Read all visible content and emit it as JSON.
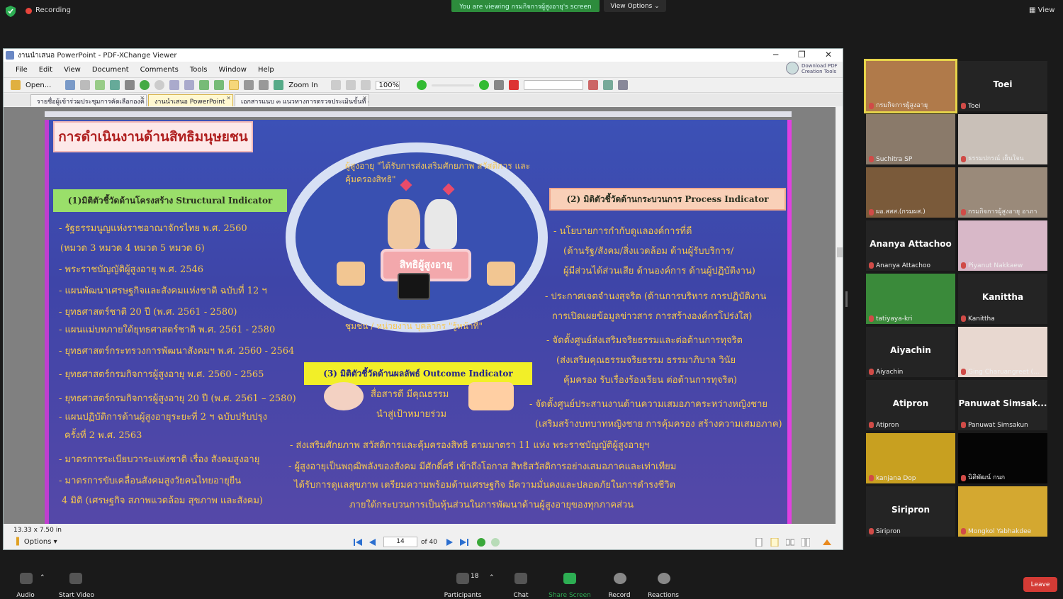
{
  "zoom": {
    "recording_label": "Recording",
    "viewing_banner": "You are viewing กรมกิจการผู้สูงอายุ's screen",
    "view_options": "View Options ⌄",
    "view_label": "View"
  },
  "window": {
    "title": "งานนำเสนอ PowerPoint - PDF-XChange Viewer",
    "menu": [
      "File",
      "Edit",
      "View",
      "Document",
      "Comments",
      "Tools",
      "Window",
      "Help"
    ],
    "download_label_1": "Download PDF",
    "download_label_2": "Creation Tools",
    "open_label": "Open...",
    "zoom_in_label": "Zoom In",
    "zoom_value": "100%",
    "tabs": [
      "รายชื่อผู้เข้าร่วมประชุมการคัดเลือกองค์",
      "งานนำเสนอ PowerPoint",
      "เอกสารแนบ ๓ แนวทางการตรวจประเมินขั้นที่ ๓"
    ],
    "page_size": "13.33 x 7.50 in",
    "options_label": "Options",
    "page_current": "14",
    "page_total": "of 40"
  },
  "slide": {
    "title": "การดำเนินงานด้านสิทธิมนุษยชน",
    "circle_top": "ผู้สูงอายุ \"ได้รับการส่งเสริมศักยภาพ สวัสดิการ และคุ้มครองสิทธิ\"",
    "circle_center": "สิทธิผู้สูงอายุ",
    "circle_bottom": "ชุมชน / หน่วยงาน บุคลากร \"รู้หน้าที่\"",
    "ind1": "(1)มิติตัวชี้วัดด้านโครงสร้าง  Structural Indicator",
    "ind2": "(2) มิติตัวชี้วัดด้านกระบวนการ Process Indicator",
    "ind3": "(3) มิติตัวชี้วัดด้านผลลัพธ์ Outcome Indicator",
    "left_items": [
      "- รัฐธรรมนูญแห่งราชอาณาจักรไทย พ.ศ. 2560",
      "(หมวด 3 หมวด 4 หมวด 5 หมวด 6)",
      "- พระราชบัญญัติผู้สูงอายุ พ.ศ. 2546",
      "- แผนพัฒนาเศรษฐกิจและสังคมแห่งชาติ ฉบับที่ 12 ฯ",
      "- ยุทธศาสตร์ชาติ 20 ปี (พ.ศ. 2561 - 2580)",
      "- แผนแม่บทภายใต้ยุทธศาสตร์ชาติ พ.ศ. 2561 - 2580",
      "- ยุทธศาสตร์กระทรวงการพัฒนาสังคมฯ พ.ศ. 2560 - 2564",
      "- ยุทธศาสตร์กรมกิจการผู้สูงอายุ พ.ศ. 2560 - 2565",
      "- ยุทธศาสตร์กรมกิจการผู้สูงอายุ 20 ปี (พ.ศ. 2561 – 2580)",
      "- แผนปฏิบัติการด้านผู้สูงอายุระยะที่ 2 ฯ ฉบับปรับปรุง",
      "ครั้งที่ 2 พ.ศ. 2563",
      "- มาตรการระเบียบวาระแห่งชาติ เรื่อง สังคมสูงอายุ",
      "- มาตรการขับเคลื่อนสังคมสูงวัยคนไทยอายุยืน",
      "4 มิติ (เศรษฐกิจ สภาพแวดล้อม สุขภาพ และสังคม)"
    ],
    "right_items": [
      "- นโยบายการกำกับดูแลองค์การที่ดี",
      "(ด้านรัฐ/สังคม/สิ่งแวดล้อม ด้านผู้รับบริการ/",
      "ผู้มีส่วนได้ส่วนเสีย ด้านองค์การ ด้านผู้ปฏิบัติงาน)",
      "- ประกาศเจตจำนงสุจริต (ด้านการบริหาร การปฏิบัติงาน",
      "การเปิดเผยข้อมูลข่าวสาร การสร้างองค์กรโปร่งใส)",
      "- จัดตั้งศูนย์ส่งเสริมจริยธรรมและต่อต้านการทุจริต",
      "(ส่งเสริมคุณธรรมจริยธรรม ธรรมาภิบาล วินัย",
      "คุ้มครอง รับเรื่องร้องเรียน ต่อต้านการทุจริต)"
    ],
    "media_1": "สื่อสารดี มีคุณธรรม",
    "media_2": "นำสู่เป้าหมายร่วม",
    "gender_1": "- จัดตั้งศูนย์ประสานงานด้านความเสมอภาคระหว่างหญิงชาย",
    "gender_2": "(เสริมสร้างบทบาทหญิงชาย การคุ้มครอง สร้างความเสมอภาค)",
    "bottom_1": "- ส่งเสริมศักยภาพ สวัสดิการและคุ้มครองสิทธิ  ตามมาตรา 11 แห่ง พระราชบัญญัติผู้สูงอายุฯ",
    "bottom_2": "- ผู้สูงอายุเป็นพฤฒิพลังของสังคม มีศักดิ์ศรี เข้าถึงโอกาส สิทธิสวัสดิการอย่างเสมอภาคและเท่าเทียม",
    "bottom_3": "ได้รับการดูแลสุขภาพ เตรียมความพร้อมด้านเศรษฐกิจ มีความมั่นคงและปลอดภัยในการดำรงชีวิต",
    "bottom_4": "ภายใต้กระบวนการเป็นหุ้นส่วนในการพัฒนาด้านผู้สูงอายุของทุกภาคส่วน"
  },
  "participants_panel": [
    {
      "name": "กรมกิจการผู้สูงอายุ",
      "big": "",
      "video": true,
      "color": "#b07a4a"
    },
    {
      "name": "Toei",
      "big": "Toei",
      "video": false,
      "color": ""
    },
    {
      "name": "Suchitra SP",
      "big": "",
      "video": true,
      "color": "#8a7a6a"
    },
    {
      "name": "ธรรมปกรณ์ เย็นใจน",
      "big": "",
      "video": true,
      "color": "#c9c0b8"
    },
    {
      "name": "ผอ.สสส.(กรมผส.)",
      "big": "",
      "video": true,
      "color": "#7a5a3a"
    },
    {
      "name": "กรมกิจการผู้สูงอายุ อาภา",
      "big": "",
      "video": true,
      "color": "#9a8a7a"
    },
    {
      "name": "Ananya Attachoo",
      "big": "Ananya Attachoo",
      "video": false,
      "color": ""
    },
    {
      "name": "Piyanut Nakkaew",
      "big": "",
      "video": true,
      "color": "#d8b8c8"
    },
    {
      "name": "tatiyaya-kri",
      "big": "",
      "video": true,
      "color": "#3a8a3a"
    },
    {
      "name": "Kanittha",
      "big": "Kanittha",
      "video": false,
      "color": ""
    },
    {
      "name": "Aiyachin",
      "big": "Aiyachin",
      "video": false,
      "color": ""
    },
    {
      "name": "Ging Charuangreet (...",
      "big": "",
      "video": true,
      "color": "#e8d8d0"
    },
    {
      "name": "Atipron",
      "big": "Atipron",
      "video": false,
      "color": ""
    },
    {
      "name": "Panuwat Simsakun",
      "big": "Panuwat  Simsak...",
      "video": false,
      "color": ""
    },
    {
      "name": "kanjana Dop",
      "big": "",
      "video": true,
      "color": "#c8a020"
    },
    {
      "name": "นิติพัฒน์ กนก",
      "big": "",
      "video": true,
      "color": "#050505"
    },
    {
      "name": "Siripron",
      "big": "Siripron",
      "video": false,
      "color": ""
    },
    {
      "name": "Mongkol Yabhakdee",
      "big": "",
      "video": true,
      "color": "#d4a830"
    }
  ],
  "bottom_bar": {
    "audio": "Audio",
    "start_video": "Start Video",
    "participants": "Participants",
    "participants_count": "18",
    "chat": "Chat",
    "share_screen": "Share Screen",
    "record": "Record",
    "reactions": "Reactions",
    "leave": "Leave"
  },
  "colors": {
    "share_green": "#2dae53",
    "leave_red": "#d43b35",
    "active_speaker": "#e7d44a"
  }
}
